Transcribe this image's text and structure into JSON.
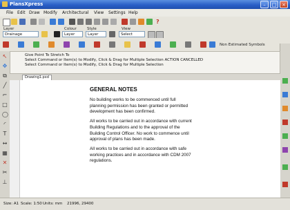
{
  "window": {
    "title": "PlansXpress"
  },
  "menu": [
    "File",
    "Edit",
    "Draw",
    "Modify",
    "Architectural",
    "View",
    "Settings",
    "Help"
  ],
  "layer_bar": {
    "layer_label": "Layer",
    "layer_value": "Drainage",
    "colour_label": "Colour",
    "colour_value": "Layer",
    "style_label": "Style",
    "style_value": "Layer",
    "view_label": "View",
    "view_value": "Select View..."
  },
  "snap_toolbar": {
    "snap_mode": "Non Estimated Symbols"
  },
  "command": {
    "line1": "Give Point To Stretch To",
    "line2": "Select Command or Item(s) to Modify, Click & Drag for Multiple Selection ACTION CANCELLED",
    "line3": "Select Command or Item(s) to Modify, Click & Drag for Multiple Selection"
  },
  "tabs": [
    "Drawing1.pxd"
  ],
  "notes": {
    "heading": "GENERAL NOTES",
    "paragraphs": [
      "No building works to be commenced until full planning permission has been granted or permitted development has been confirmed.",
      "All works to be carried out in accordance with current Building Regulations and to the approval of the Building Control Officer. No work to commence until approval of plans has been made.",
      "All works to be carried out in accordance with safe working practices and in accordance with CDM 2007 regulations."
    ]
  },
  "status": {
    "size": "Size: A1",
    "scale": "Scale: 1:50",
    "units": "Units: mm",
    "coords": "21996, 29400"
  },
  "colors": {
    "titlebar": "#2a5fc7",
    "canvas": "#ffffff",
    "chrome": "#d8d6cf"
  }
}
